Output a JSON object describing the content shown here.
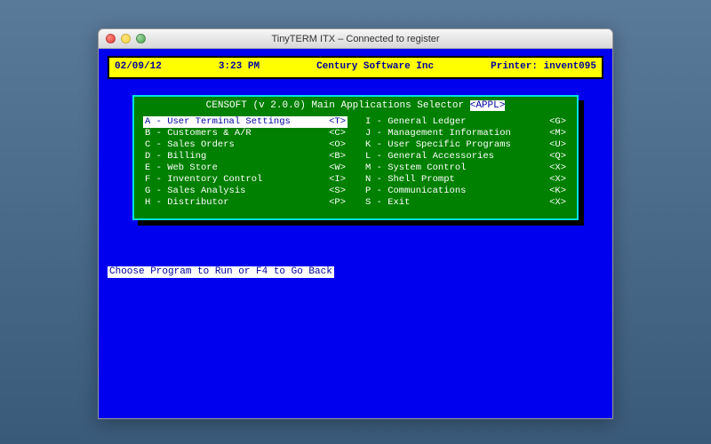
{
  "window": {
    "title": "TinyTERM ITX – Connected to register"
  },
  "infobar": {
    "date": "02/09/12",
    "time": "3:23 PM",
    "company": "Century Software Inc",
    "printer_label": "Printer: invent095"
  },
  "menu": {
    "title_prefix": "CENSOFT (v 2.0.0) Main Applications Selector ",
    "title_tag": "<APPL>",
    "selected_key": "A",
    "left": [
      {
        "key": "A",
        "label": "User Terminal Settings",
        "shortcut": "<T>"
      },
      {
        "key": "B",
        "label": "Customers & A/R",
        "shortcut": "<C>"
      },
      {
        "key": "C",
        "label": "Sales Orders",
        "shortcut": "<O>"
      },
      {
        "key": "D",
        "label": "Billing",
        "shortcut": "<B>"
      },
      {
        "key": "E",
        "label": "Web Store",
        "shortcut": "<W>"
      },
      {
        "key": "F",
        "label": "Inventory Control",
        "shortcut": "<I>"
      },
      {
        "key": "G",
        "label": "Sales Analysis",
        "shortcut": "<S>"
      },
      {
        "key": "H",
        "label": "Distributor",
        "shortcut": "<P>"
      }
    ],
    "right": [
      {
        "key": "I",
        "label": "General Ledger",
        "shortcut": "<G>"
      },
      {
        "key": "J",
        "label": "Management Information",
        "shortcut": "<M>"
      },
      {
        "key": "K",
        "label": "User Specific Programs",
        "shortcut": "<U>"
      },
      {
        "key": "L",
        "label": "General Accessories",
        "shortcut": "<Q>"
      },
      {
        "key": "M",
        "label": "System Control",
        "shortcut": "<X>"
      },
      {
        "key": "N",
        "label": "Shell Prompt",
        "shortcut": "<X>"
      },
      {
        "key": "P",
        "label": "Communications",
        "shortcut": "<K>"
      },
      {
        "key": "S",
        "label": "Exit",
        "shortcut": "<X>"
      }
    ]
  },
  "prompt": "Choose Program to Run or F4 to Go Back"
}
